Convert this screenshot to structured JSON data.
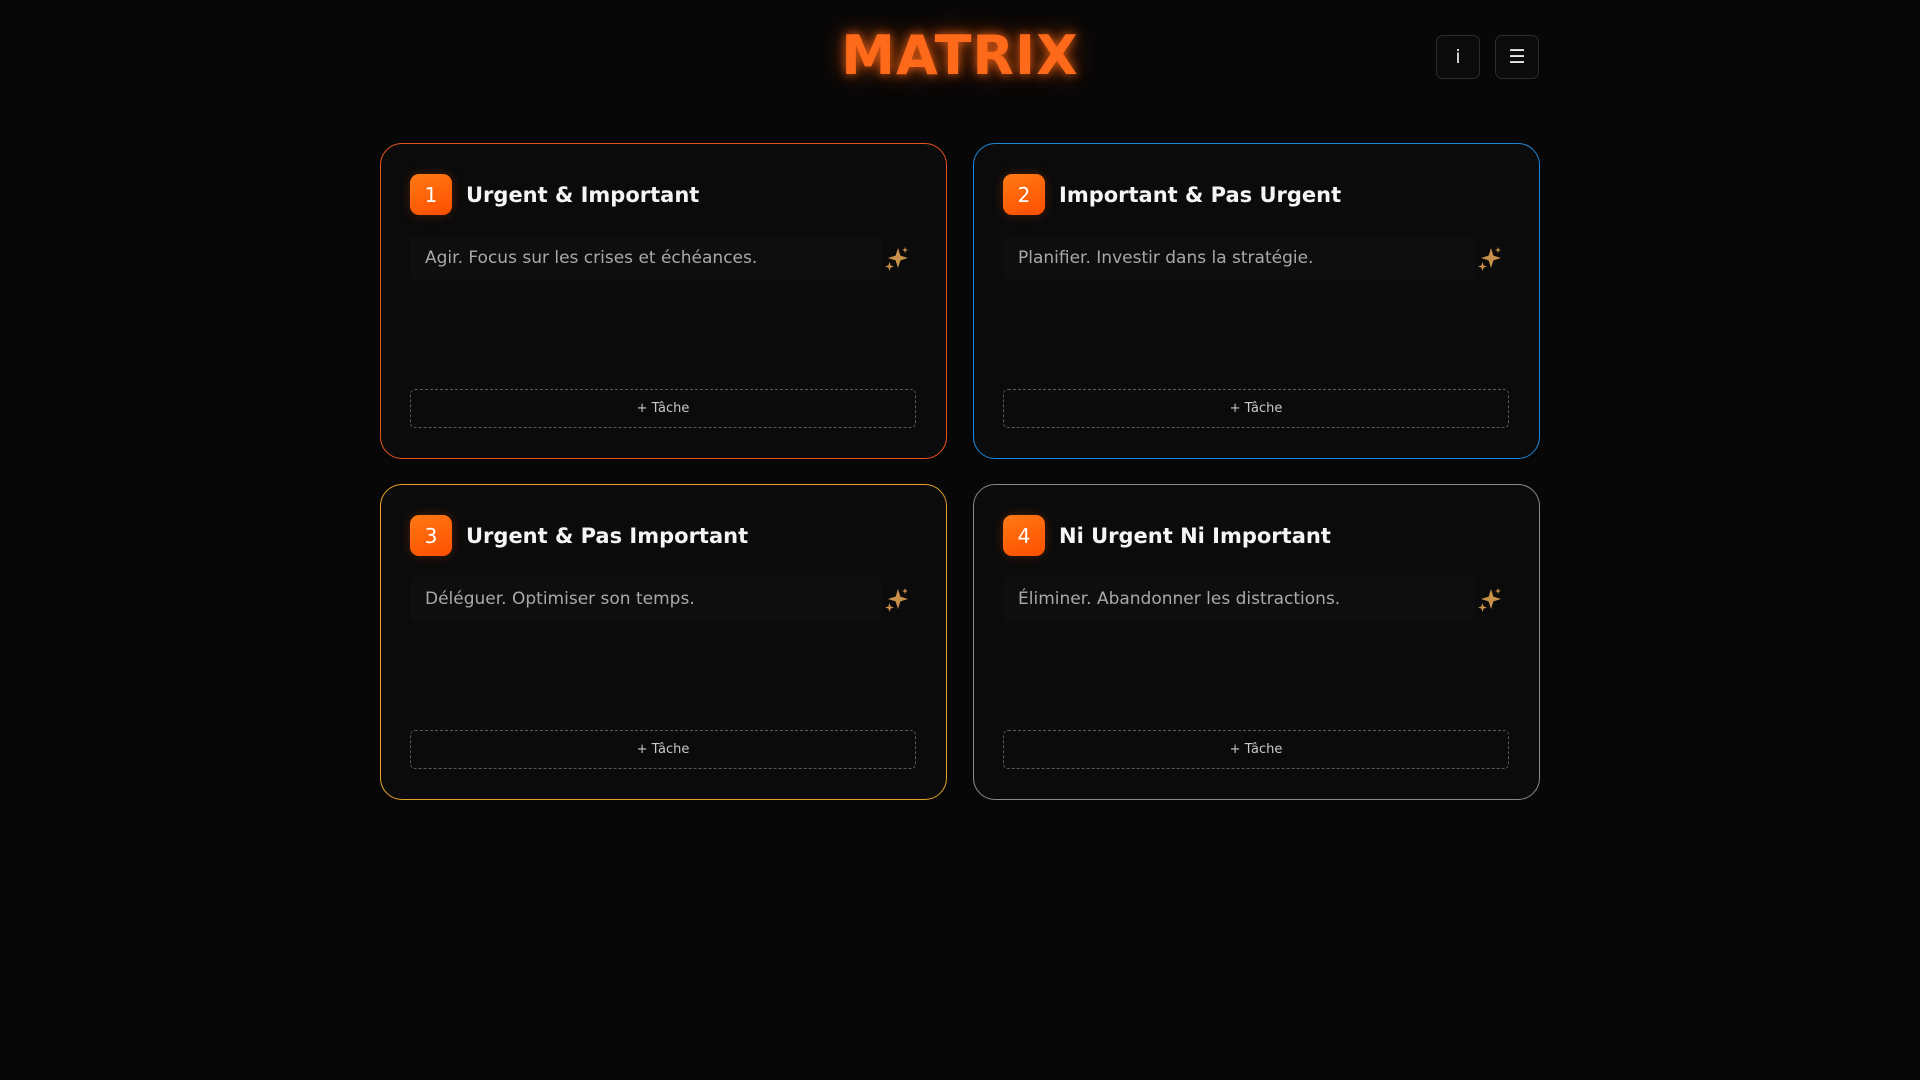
{
  "header": {
    "title": "MATRIX",
    "info_label": "i",
    "menu_label": "☰"
  },
  "colors": {
    "accent": "#ff6a1a",
    "quadrant_1_border": "#e6531f",
    "quadrant_2_border": "#1f86d6",
    "quadrant_3_border": "#e3a12a",
    "quadrant_4_border": "#8a8a8a",
    "sparkle": "#c9904a"
  },
  "quadrants": [
    {
      "number": "1",
      "title": "Urgent & Important",
      "description": "Agir. Focus sur les crises et échéances.",
      "add_label": "+ Tâche",
      "icon": "sparkles-icon"
    },
    {
      "number": "2",
      "title": "Important & Pas Urgent",
      "description": "Planifier. Investir dans la stratégie.",
      "add_label": "+ Tâche",
      "icon": "sparkles-icon"
    },
    {
      "number": "3",
      "title": "Urgent & Pas Important",
      "description": "Déléguer. Optimiser son temps.",
      "add_label": "+ Tâche",
      "icon": "sparkles-icon"
    },
    {
      "number": "4",
      "title": "Ni Urgent Ni Important",
      "description": "Éliminer. Abandonner les distractions.",
      "add_label": "+ Tâche",
      "icon": "sparkles-icon"
    }
  ]
}
